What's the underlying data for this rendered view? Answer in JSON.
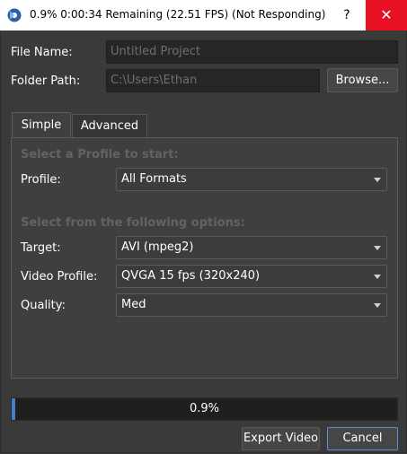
{
  "window": {
    "title": "0.9%  0:00:34 Remaining (22.51 FPS) (Not Responding)",
    "help_label": "?",
    "close_label": "✕"
  },
  "file": {
    "file_name_label": "File Name:",
    "file_name_value": "Untitled Project",
    "folder_path_label": "Folder Path:",
    "folder_path_value": "C:\\Users\\Ethan",
    "browse_label": "Browse..."
  },
  "tabs": [
    {
      "label": "Simple",
      "active": true
    },
    {
      "label": "Advanced",
      "active": false
    }
  ],
  "simple": {
    "section_profile": "Select a Profile to start:",
    "profile_label": "Profile:",
    "profile_value": "All Formats",
    "section_options": "Select from the following options:",
    "target_label": "Target:",
    "target_value": "AVI (mpeg2)",
    "video_profile_label": "Video Profile:",
    "video_profile_value": "QVGA 15 fps (320x240)",
    "quality_label": "Quality:",
    "quality_value": "Med"
  },
  "progress": {
    "text": "0.9%",
    "fraction": 0.009
  },
  "actions": {
    "export_label": "Export Video",
    "cancel_label": "Cancel"
  },
  "colors": {
    "accent": "#3f7fd4",
    "close_button": "#e81123"
  }
}
